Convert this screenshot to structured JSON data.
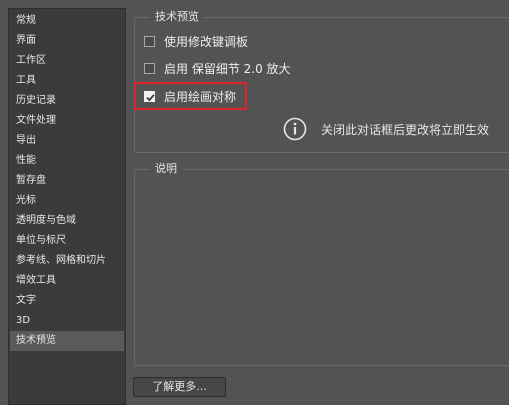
{
  "sidebar": {
    "items": [
      {
        "label": "常规"
      },
      {
        "label": "界面"
      },
      {
        "label": "工作区"
      },
      {
        "label": "工具"
      },
      {
        "label": "历史记录"
      },
      {
        "label": "文件处理"
      },
      {
        "label": "导出"
      },
      {
        "label": "性能"
      },
      {
        "label": "暂存盘"
      },
      {
        "label": "光标"
      },
      {
        "label": "透明度与色域"
      },
      {
        "label": "单位与标尺"
      },
      {
        "label": "参考线、网格和切片"
      },
      {
        "label": "增效工具"
      },
      {
        "label": "文字"
      },
      {
        "label": "3D"
      },
      {
        "label": "技术预览"
      }
    ],
    "selected_index": 16
  },
  "tech_preview": {
    "title": "技术预览",
    "options": [
      {
        "label": "使用修改键调板",
        "checked": false
      },
      {
        "label": "启用 保留细节 2.0 放大",
        "checked": false
      },
      {
        "label": "启用绘画对称",
        "checked": true
      }
    ],
    "info_text": "关闭此对话框后更改将立即生效"
  },
  "description": {
    "title": "说明"
  },
  "learn_more_label": "了解更多..."
}
